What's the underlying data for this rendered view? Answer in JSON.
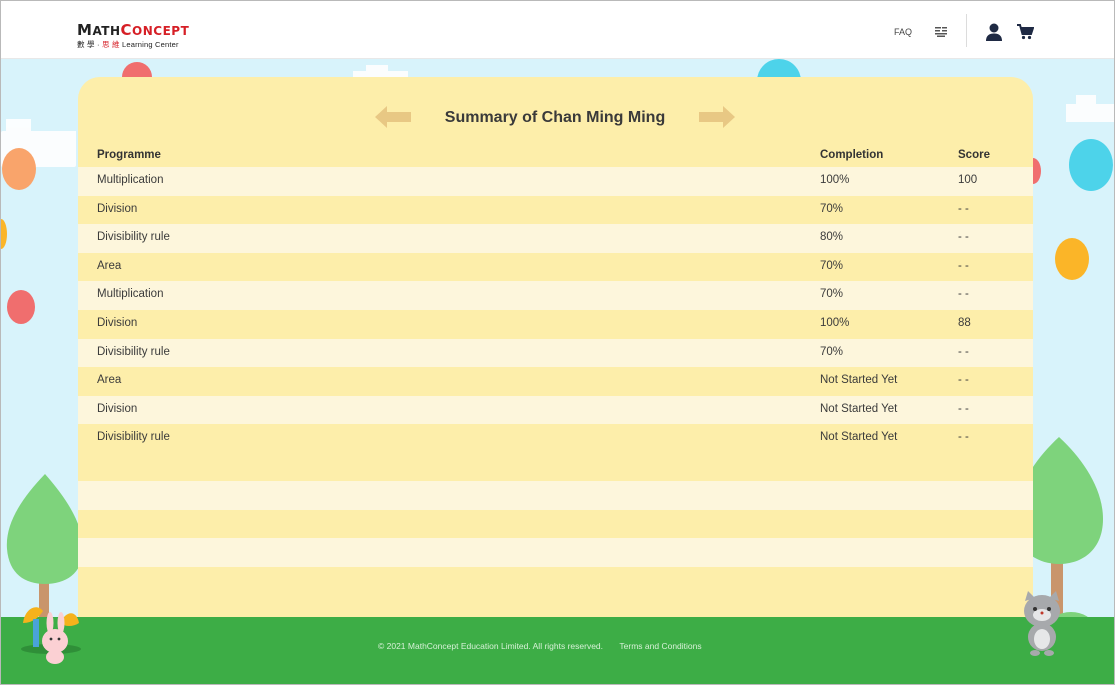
{
  "header": {
    "logo_main_a": "M",
    "logo_main_b": "ATH",
    "logo_main_c": "C",
    "logo_main_d": "ONCEPT",
    "logo_sub_a": "數 學 ·",
    "logo_sub_b": "思 維",
    "logo_sub_c": "Learning Center",
    "faq_label": "FAQ"
  },
  "summary": {
    "title": "Summary of Chan Ming Ming",
    "columns": {
      "programme": "Programme",
      "completion": "Completion",
      "score": "Score"
    },
    "rows": [
      {
        "programme": "Multiplication",
        "completion": "100%",
        "score": "100"
      },
      {
        "programme": "Division",
        "completion": "70%",
        "score": "- -"
      },
      {
        "programme": "Divisibility rule",
        "completion": "80%",
        "score": "- -"
      },
      {
        "programme": "Area",
        "completion": "70%",
        "score": "- -"
      },
      {
        "programme": "Multiplication",
        "completion": "70%",
        "score": "- -"
      },
      {
        "programme": "Division",
        "completion": "100%",
        "score": "88"
      },
      {
        "programme": "Divisibility rule",
        "completion": "70%",
        "score": "- -"
      },
      {
        "programme": "Area",
        "completion": "Not Started Yet",
        "score": "- -"
      },
      {
        "programme": "Division",
        "completion": "Not Started Yet",
        "score": "- -"
      },
      {
        "programme": "Divisibility rule",
        "completion": "Not Started Yet",
        "score": "- -"
      }
    ]
  },
  "footer": {
    "copyright": "© 2021 MathConcept Education Limited. All rights reserved.",
    "terms": "Terms and Conditions"
  },
  "icons": {
    "prev": "arrow-left-icon",
    "next": "arrow-right-icon",
    "language": "language-icon",
    "user": "user-icon",
    "cart": "cart-icon"
  },
  "colors": {
    "panel": "#fdeeaa",
    "row_light": "#fdf6dc",
    "sky": "#d8f3fb",
    "grass": "#3dad46",
    "arrow": "#e8c884",
    "brand_red": "#d61f26"
  }
}
